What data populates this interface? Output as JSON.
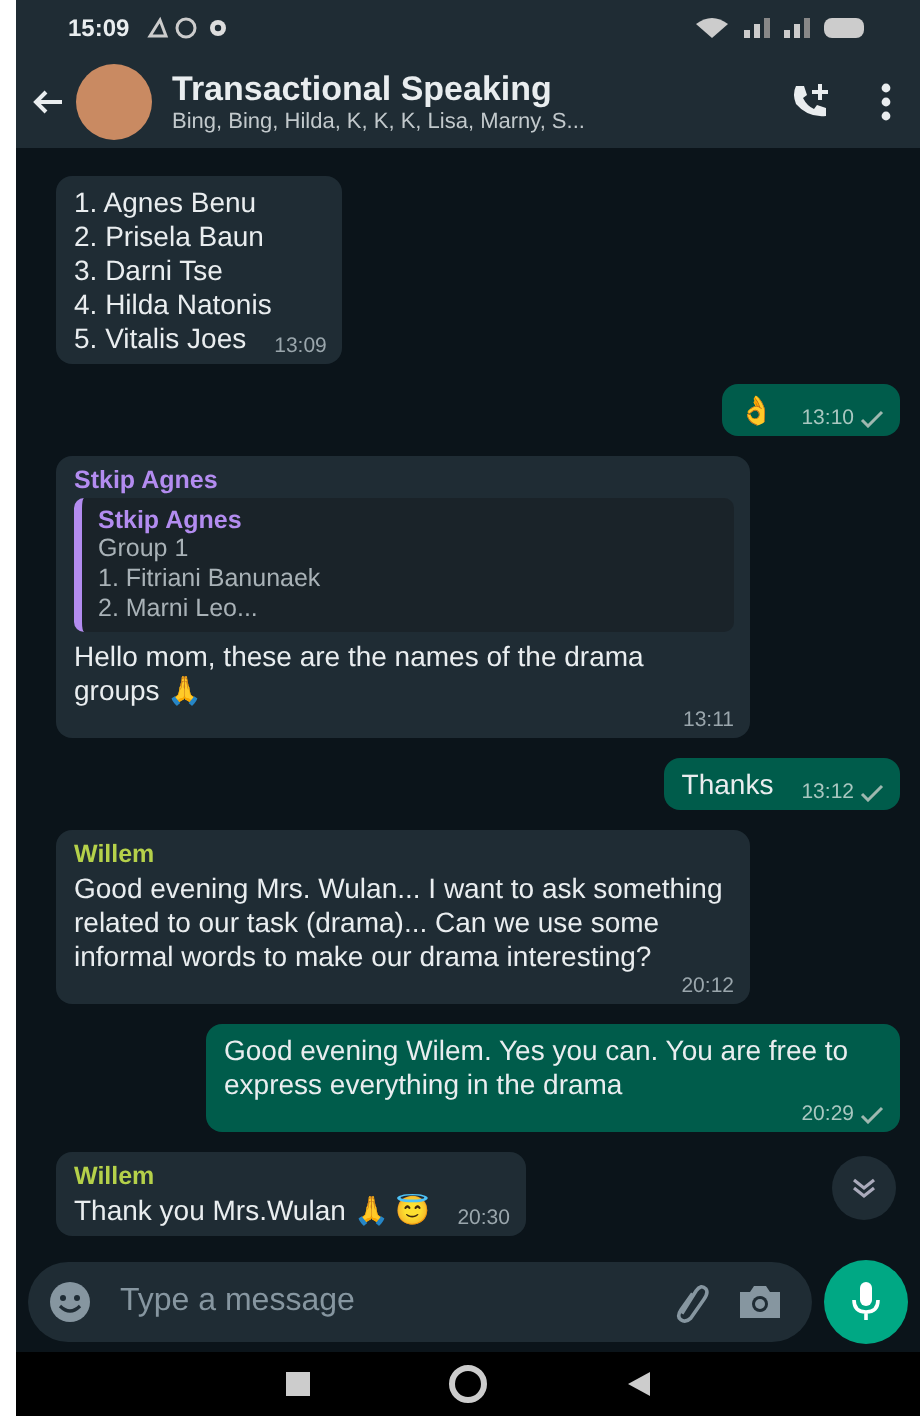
{
  "status_bar": {
    "time": "15:09"
  },
  "header": {
    "title": "Transactional Speaking",
    "subtitle": "Bing, Bing, Hilda, K, K, K, Lisa, Marny, S..."
  },
  "messages": [
    {
      "kind": "incoming",
      "lines": [
        "1. Agnes Benu",
        "2. Prisela Baun",
        "3. Darni Tse",
        "4. Hilda Natonis",
        "5. Vitalis Joes"
      ],
      "time": "13:09"
    },
    {
      "kind": "outgoing",
      "lines": [
        "👌"
      ],
      "time": "13:10",
      "read": false
    },
    {
      "kind": "incoming",
      "sender": "Stkip Agnes",
      "color": "#b38cf0",
      "quote": {
        "sender": "Stkip Agnes",
        "lines": [
          "Group 1",
          "1. Fitriani Banunaek",
          "2. Marni Leo..."
        ]
      },
      "lines": [
        "Hello mom, these are the names of the drama groups 🙏"
      ],
      "time": "13:11"
    },
    {
      "kind": "outgoing",
      "lines": [
        "Thanks"
      ],
      "time": "13:12",
      "read": false
    },
    {
      "kind": "incoming",
      "sender": "Willem",
      "color": "#b5d14a",
      "lines": [
        "Good evening Mrs. Wulan... I want to ask something related to our task (drama)... Can we use some informal words to make our drama interesting?"
      ],
      "time": "20:12"
    },
    {
      "kind": "outgoing",
      "lines": [
        "Good evening Wilem. Yes you can. You are free to express everything in the drama"
      ],
      "time": "20:29",
      "read": false
    },
    {
      "kind": "incoming",
      "sender": "Willem",
      "color": "#b5d14a",
      "lines": [
        "Thank you Mrs.Wulan 🙏 😇"
      ],
      "time": "20:30"
    }
  ],
  "composer": {
    "placeholder": "Type a message"
  }
}
